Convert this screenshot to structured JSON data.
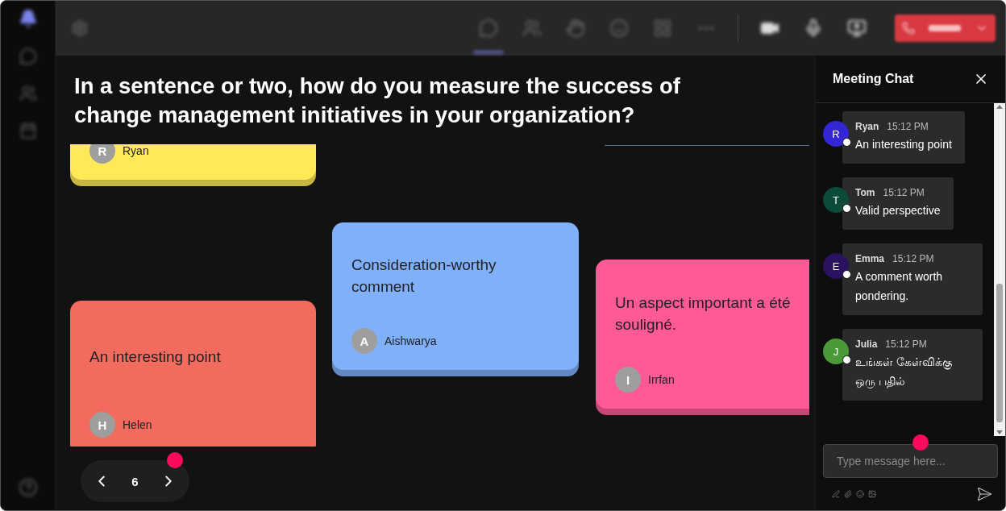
{
  "question": "In a sentence or two, how do you measure the success of change management initiatives in your organization?",
  "cards": [
    {
      "color": "#ffe957",
      "initial": "R",
      "author": "Ryan"
    },
    {
      "color": "#f26b5f",
      "text": "An interesting point",
      "initial": "H",
      "author": "Helen"
    },
    {
      "color": "#7fb0f9",
      "text": "Consideration-worthy comment",
      "initial": "A",
      "author": "Aishwarya"
    },
    {
      "color": "#ff5a97",
      "text": "Un aspect important a été souligné.",
      "initial": "I",
      "author": "Irrfan"
    }
  ],
  "pager": {
    "page": "6"
  },
  "chat": {
    "title": "Meeting Chat",
    "placeholder": "Type message here...",
    "messages": [
      {
        "initial": "R",
        "color": "#3326d6",
        "name": "Ryan",
        "time": "15:12 PM",
        "text": "An interesting point"
      },
      {
        "initial": "T",
        "color": "#0c4a3a",
        "name": "Tom",
        "time": "15:12 PM",
        "text": "Valid perspective"
      },
      {
        "initial": "E",
        "color": "#2a1260",
        "name": "Emma",
        "time": "15:12 PM",
        "text": "A comment worth pondering."
      },
      {
        "initial": "J",
        "color": "#4a9a38",
        "name": "Julia",
        "time": "15:12 PM",
        "text": "உங்கள் கேள்விக்கு ஒரு பதில்"
      }
    ]
  }
}
